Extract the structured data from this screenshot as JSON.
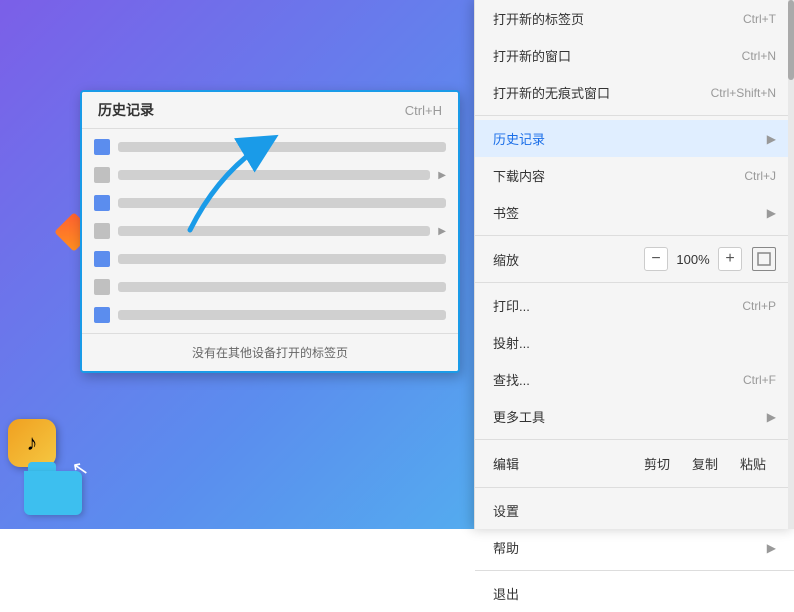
{
  "background": {
    "gradient_start": "#7b5fe8",
    "gradient_end": "#4dc8f0"
  },
  "history_submenu": {
    "title": "历史记录",
    "shortcut": "Ctrl+H",
    "items": [
      {
        "id": 1,
        "icon_color": "blue",
        "text_width": "80%",
        "has_arrow": false
      },
      {
        "id": 2,
        "icon_color": "gray",
        "text_width": "65%",
        "has_arrow": true
      },
      {
        "id": 3,
        "icon_color": "blue",
        "text_width": "70%",
        "has_arrow": false
      },
      {
        "id": 4,
        "icon_color": "gray",
        "text_width": "55%",
        "has_arrow": true
      },
      {
        "id": 5,
        "icon_color": "blue",
        "text_width": "75%",
        "has_arrow": false
      },
      {
        "id": 6,
        "icon_color": "gray",
        "text_width": "60%",
        "has_arrow": false
      },
      {
        "id": 7,
        "icon_color": "blue",
        "text_width": "80%",
        "has_arrow": false
      }
    ],
    "footer": "没有在其他设备打开的标签页"
  },
  "context_menu": {
    "items": [
      {
        "id": "new-tab",
        "label": "打开新的标签页",
        "shortcut": "Ctrl+T",
        "has_submenu": false,
        "highlighted": false,
        "divider_after": false
      },
      {
        "id": "new-window",
        "label": "打开新的窗口",
        "shortcut": "Ctrl+N",
        "has_submenu": false,
        "highlighted": false,
        "divider_after": false
      },
      {
        "id": "new-incognito",
        "label": "打开新的无痕式窗口",
        "shortcut": "Ctrl+Shift+N",
        "has_submenu": false,
        "highlighted": false,
        "divider_after": true
      },
      {
        "id": "history",
        "label": "历史记录",
        "shortcut": "",
        "has_submenu": true,
        "highlighted": true,
        "divider_after": false
      },
      {
        "id": "downloads",
        "label": "下载内容",
        "shortcut": "Ctrl+J",
        "has_submenu": false,
        "highlighted": false,
        "divider_after": false
      },
      {
        "id": "bookmarks",
        "label": "书签",
        "shortcut": "",
        "has_submenu": true,
        "highlighted": false,
        "divider_after": true
      },
      {
        "id": "print",
        "label": "打印...",
        "shortcut": "Ctrl+P",
        "has_submenu": false,
        "highlighted": false,
        "divider_after": false
      },
      {
        "id": "cast",
        "label": "投射...",
        "shortcut": "",
        "has_submenu": false,
        "highlighted": false,
        "divider_after": false
      },
      {
        "id": "find",
        "label": "查找...",
        "shortcut": "Ctrl+F",
        "has_submenu": false,
        "highlighted": false,
        "divider_after": false
      },
      {
        "id": "more-tools",
        "label": "更多工具",
        "shortcut": "",
        "has_submenu": true,
        "highlighted": false,
        "divider_after": true
      },
      {
        "id": "settings",
        "label": "设置",
        "shortcut": "",
        "has_submenu": false,
        "highlighted": false,
        "divider_after": false
      },
      {
        "id": "help",
        "label": "帮助",
        "shortcut": "",
        "has_submenu": true,
        "highlighted": false,
        "divider_after": true
      },
      {
        "id": "exit",
        "label": "退出",
        "shortcut": "",
        "has_submenu": false,
        "highlighted": false,
        "divider_after": false
      }
    ],
    "zoom": {
      "label": "缩放",
      "minus": "−",
      "value": "100%",
      "plus": "+",
      "fullscreen": true
    },
    "edit": {
      "label": "编辑",
      "cut": "剪切",
      "copy": "复制",
      "paste": "粘贴"
    }
  }
}
